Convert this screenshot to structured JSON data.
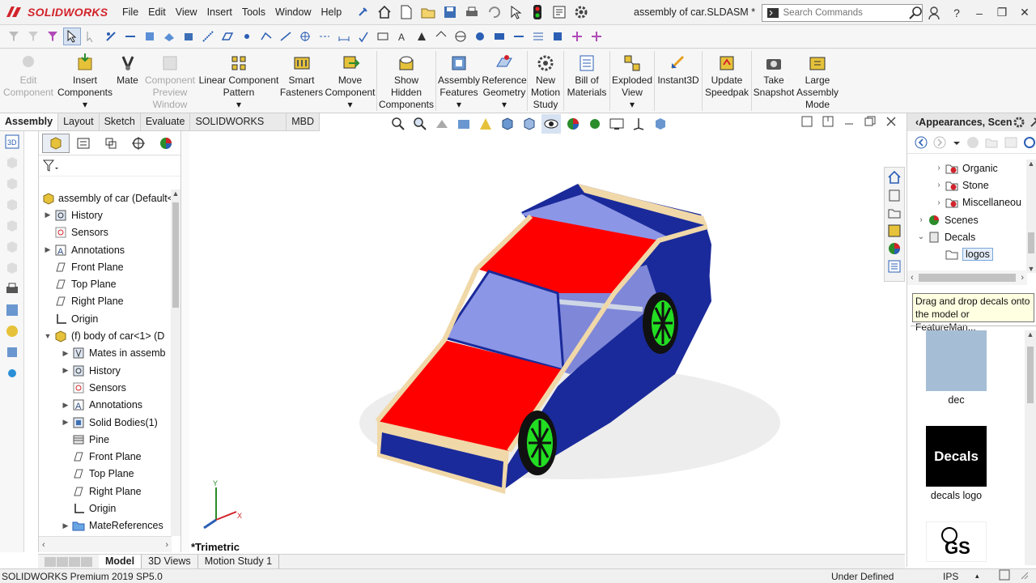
{
  "app": {
    "logo_text": "SOLIDWORKS",
    "doc_title": "assembly of car.SLDASM *"
  },
  "menu": [
    "File",
    "Edit",
    "View",
    "Insert",
    "Tools",
    "Window",
    "Help"
  ],
  "search": {
    "placeholder": "Search Commands"
  },
  "commands": [
    {
      "label": "Edit\nComponent",
      "disabled": true,
      "icon": "edit-component-icon"
    },
    {
      "label": "Insert\nComponents",
      "icon": "insert-components-icon",
      "dropdown": true
    },
    {
      "label": "Mate",
      "icon": "mate-icon"
    },
    {
      "label": "Component\nPreview\nWindow",
      "disabled": true,
      "icon": "component-preview-icon"
    },
    {
      "label": "Linear Component\nPattern",
      "icon": "linear-pattern-icon",
      "dropdown": true
    },
    {
      "label": "Smart\nFasteners",
      "icon": "smart-fasteners-icon"
    },
    {
      "label": "Move\nComponent",
      "icon": "move-component-icon",
      "dropdown": true
    },
    {
      "label": "Show\nHidden\nComponents",
      "icon": "show-hidden-icon"
    },
    {
      "label": "Assembly\nFeatures",
      "icon": "assembly-features-icon",
      "dropdown": true
    },
    {
      "label": "Reference\nGeometry",
      "icon": "reference-geometry-icon",
      "dropdown": true
    },
    {
      "label": "New\nMotion\nStudy",
      "icon": "motion-study-icon"
    },
    {
      "label": "Bill of\nMaterials",
      "icon": "bom-icon"
    },
    {
      "label": "Exploded\nView",
      "icon": "exploded-view-icon",
      "dropdown": true
    },
    {
      "label": "Instant3D",
      "icon": "instant3d-icon"
    },
    {
      "label": "Update\nSpeedpak",
      "icon": "speedpak-icon"
    },
    {
      "label": "Take\nSnapshot",
      "icon": "snapshot-icon"
    },
    {
      "label": "Large\nAssembly\nMode",
      "icon": "large-assembly-icon"
    }
  ],
  "tabs": [
    "Assembly",
    "Layout",
    "Sketch",
    "Evaluate",
    "SOLIDWORKS Add-Ins",
    "MBD"
  ],
  "feature_tree": [
    {
      "level": 0,
      "arrow": "",
      "icon": "assembly-icon",
      "label": "assembly of car  (Default<"
    },
    {
      "level": 1,
      "arrow": "▶",
      "icon": "history-icon",
      "label": "History"
    },
    {
      "level": 1,
      "arrow": "",
      "icon": "sensors-icon",
      "label": "Sensors"
    },
    {
      "level": 1,
      "arrow": "▶",
      "icon": "annotations-icon",
      "label": "Annotations"
    },
    {
      "level": 1,
      "arrow": "",
      "icon": "plane-icon",
      "label": "Front Plane"
    },
    {
      "level": 1,
      "arrow": "",
      "icon": "plane-icon",
      "label": "Top Plane"
    },
    {
      "level": 1,
      "arrow": "",
      "icon": "plane-icon",
      "label": "Right Plane"
    },
    {
      "level": 1,
      "arrow": "",
      "icon": "origin-icon",
      "label": "Origin"
    },
    {
      "level": 1,
      "arrow": "▼",
      "icon": "part-icon",
      "label": "(f) body of car<1> (D"
    },
    {
      "level": 2,
      "arrow": "▶",
      "icon": "mates-icon",
      "label": "Mates in assemb"
    },
    {
      "level": 2,
      "arrow": "▶",
      "icon": "history-icon",
      "label": "History"
    },
    {
      "level": 2,
      "arrow": "",
      "icon": "sensors-icon",
      "label": "Sensors"
    },
    {
      "level": 2,
      "arrow": "▶",
      "icon": "annotations-icon",
      "label": "Annotations"
    },
    {
      "level": 2,
      "arrow": "▶",
      "icon": "solid-bodies-icon",
      "label": "Solid Bodies(1)"
    },
    {
      "level": 2,
      "arrow": "",
      "icon": "material-icon",
      "label": "Pine"
    },
    {
      "level": 2,
      "arrow": "",
      "icon": "plane-icon",
      "label": "Front Plane"
    },
    {
      "level": 2,
      "arrow": "",
      "icon": "plane-icon",
      "label": "Top Plane"
    },
    {
      "level": 2,
      "arrow": "",
      "icon": "plane-icon",
      "label": "Right Plane"
    },
    {
      "level": 2,
      "arrow": "",
      "icon": "origin-icon",
      "label": "Origin"
    },
    {
      "level": 2,
      "arrow": "▶",
      "icon": "folder-icon",
      "label": "MateReferences"
    }
  ],
  "viewport": {
    "view_name": "*Trimetric"
  },
  "taskpane": {
    "title": "Appearances, Scen",
    "tree": [
      {
        "level": 1,
        "arrow": "›",
        "icon": "appearance-folder-icon",
        "label": "Organic"
      },
      {
        "level": 1,
        "arrow": "›",
        "icon": "appearance-folder-icon",
        "label": "Stone"
      },
      {
        "level": 1,
        "arrow": "›",
        "icon": "appearance-folder-icon",
        "label": "Miscellaneou"
      },
      {
        "level": 0,
        "arrow": "›",
        "icon": "scenes-icon",
        "label": "Scenes"
      },
      {
        "level": 0,
        "arrow": "⌄",
        "icon": "decals-icon",
        "label": "Decals"
      },
      {
        "level": 1,
        "arrow": "",
        "icon": "decal-folder-icon",
        "label": "logos",
        "selected": true
      }
    ],
    "tooltip": "Drag and drop decals onto the model or FeatureMan...",
    "decals": [
      {
        "label": "dec"
      },
      {
        "label": "decals logo",
        "thumb_text": "Decals"
      },
      {
        "label": "",
        "thumb_text": "GS"
      }
    ]
  },
  "bottom_tabs": [
    "Model",
    "3D Views",
    "Motion Study 1"
  ],
  "status": {
    "version": "SOLIDWORKS Premium 2019 SP5.0",
    "state": "Under Defined",
    "units": "IPS"
  },
  "colors": {
    "car_top": "#ff0000",
    "car_body": "#1a2a9a",
    "wood_edge": "#f0d8a8",
    "wheel": "#22dd22",
    "window": "#8c96e6"
  }
}
